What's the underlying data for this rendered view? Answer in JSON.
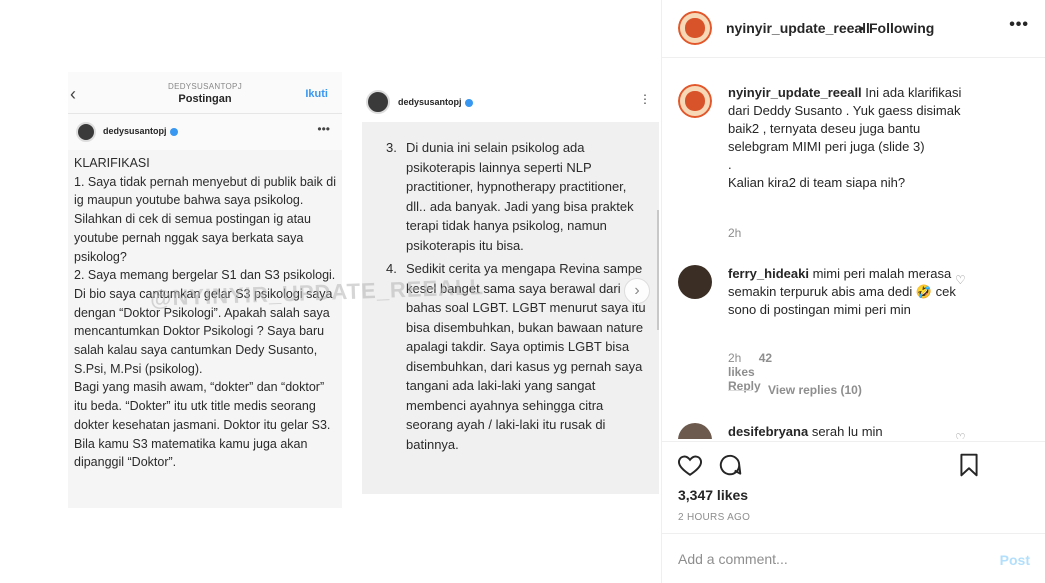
{
  "post": {
    "slide1": {
      "top_username": "DEDYSUSANTOPJ",
      "top_title": "Postingan",
      "follow_label": "Ikuti",
      "username": "dedysusantopj",
      "text": "KLARIFIKASI\n1. Saya tidak pernah menyebut di publik baik di ig maupun youtube bahwa saya psikolog. Silahkan di cek di semua postingan ig atau youtube pernah nggak saya berkata saya psikolog?\n2. Saya memang bergelar S1 dan S3 psikologi. Di bio saya cantumkan gelar S3 psikologi saya dengan “Doktor Psikologi”. Apakah salah saya mencantumkan Doktor Psikologi ? Saya baru salah kalau saya cantumkan Dedy Susanto, S.Psi, M.Psi (psikolog).\nBagi yang masih awam, “dokter” dan “doktor” itu beda. “Dokter” itu utk title medis seorang dokter kesehatan jasmani. Doktor itu gelar S3. Bila kamu S3 matematika kamu juga akan dipanggil “Doktor”."
    },
    "slide2": {
      "username": "dedysusantopj",
      "items": [
        {
          "num": "3.",
          "text": "Di dunia ini selain psikolog ada psikoterapis lainnya seperti NLP practitioner, hypnotherapy practitioner, dll.. ada banyak. Jadi yang bisa praktek terapi tidak hanya psikolog, namun psikoterapis itu bisa."
        },
        {
          "num": "4.",
          "text": "Sedikit cerita ya mengapa Revina sampe kesel banget sama saya berawal dari bahas soal LGBT. LGBT menurut saya itu bisa disembuhkan, bukan bawaan nature apalagi takdir. Saya optimis LGBT bisa disembuhkan, dari kasus yg pernah saya tangani ada laki-laki yang sangat membenci ayahnya sehingga citra seorang ayah / laki-laki itu rusak di batinnya."
        }
      ]
    },
    "watermark": "@NYINYIR_UPDATE_REEALL"
  },
  "panel": {
    "account": "nyinyir_update_reeall",
    "separator": "•",
    "following_label": "Following",
    "more_icon": "more-horizontal-icon",
    "caption": {
      "username": "nyinyir_update_reeall",
      "text": "Ini ada klarifikasi dari Deddy Susanto . Yuk gaess disimak baik2 , ternyata deseu juga bantu selebgram MIMI peri juga (slide 3)\n.\nKalian kira2 di team siapa nih?",
      "time": "2h"
    },
    "comments": [
      {
        "username": "ferry_hideaki",
        "text": "mimi peri malah merasa semakin terpuruk abis ama dedi 🤣 cek sono di postingan mimi peri min",
        "time": "2h",
        "likes": "42 likes",
        "reply_label": "Reply",
        "view_replies": "View replies (10)"
      },
      {
        "username": "desifebryana",
        "text": "serah lu min"
      }
    ],
    "likes": "3,347 likes",
    "posted": "2 HOURS AGO",
    "comment_placeholder": "Add a comment...",
    "post_label": "Post",
    "accent": "#3897f0"
  }
}
